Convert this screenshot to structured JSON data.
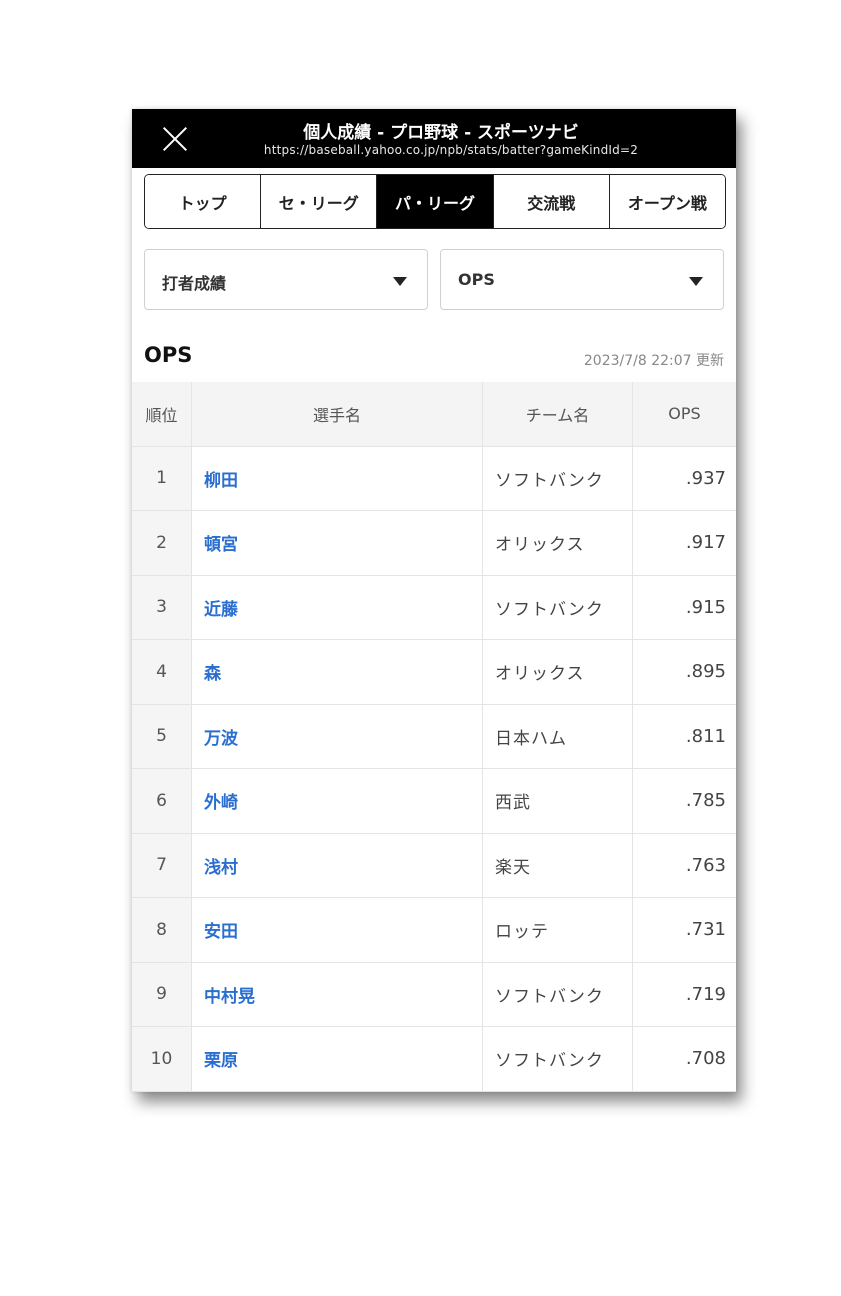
{
  "titlebar": {
    "title": "個人成績 - プロ野球 - スポーツナビ",
    "url": "https://baseball.yahoo.co.jp/npb/stats/batter?gameKindId=2",
    "close_icon": "close-icon"
  },
  "tabs": [
    {
      "label": "トップ",
      "active": false
    },
    {
      "label": "セ・リーグ",
      "active": false
    },
    {
      "label": "パ・リーグ",
      "active": true
    },
    {
      "label": "交流戦",
      "active": false
    },
    {
      "label": "オープン戦",
      "active": false
    }
  ],
  "filters": {
    "category": "打者成績",
    "stat": "OPS"
  },
  "section": {
    "title": "OPS",
    "updated": "2023/7/8 22:07 更新"
  },
  "table": {
    "headers": {
      "rank": "順位",
      "name": "選手名",
      "team": "チーム名",
      "stat": "OPS"
    },
    "rows": [
      {
        "rank": "1",
        "name": "柳田",
        "team": "ソフトバンク",
        "ops": ".937"
      },
      {
        "rank": "2",
        "name": "頓宮",
        "team": "オリックス",
        "ops": ".917"
      },
      {
        "rank": "3",
        "name": "近藤",
        "team": "ソフトバンク",
        "ops": ".915"
      },
      {
        "rank": "4",
        "name": "森",
        "team": "オリックス",
        "ops": ".895"
      },
      {
        "rank": "5",
        "name": "万波",
        "team": "日本ハム",
        "ops": ".811"
      },
      {
        "rank": "6",
        "name": "外崎",
        "team": "西武",
        "ops": ".785"
      },
      {
        "rank": "7",
        "name": "浅村",
        "team": "楽天",
        "ops": ".763"
      },
      {
        "rank": "8",
        "name": "安田",
        "team": "ロッテ",
        "ops": ".731"
      },
      {
        "rank": "9",
        "name": "中村晃",
        "team": "ソフトバンク",
        "ops": ".719"
      },
      {
        "rank": "10",
        "name": "栗原",
        "team": "ソフトバンク",
        "ops": ".708"
      }
    ]
  },
  "colors": {
    "link": "#2a6fd0",
    "titlebar": "#000000",
    "active_tab": "#000000"
  }
}
